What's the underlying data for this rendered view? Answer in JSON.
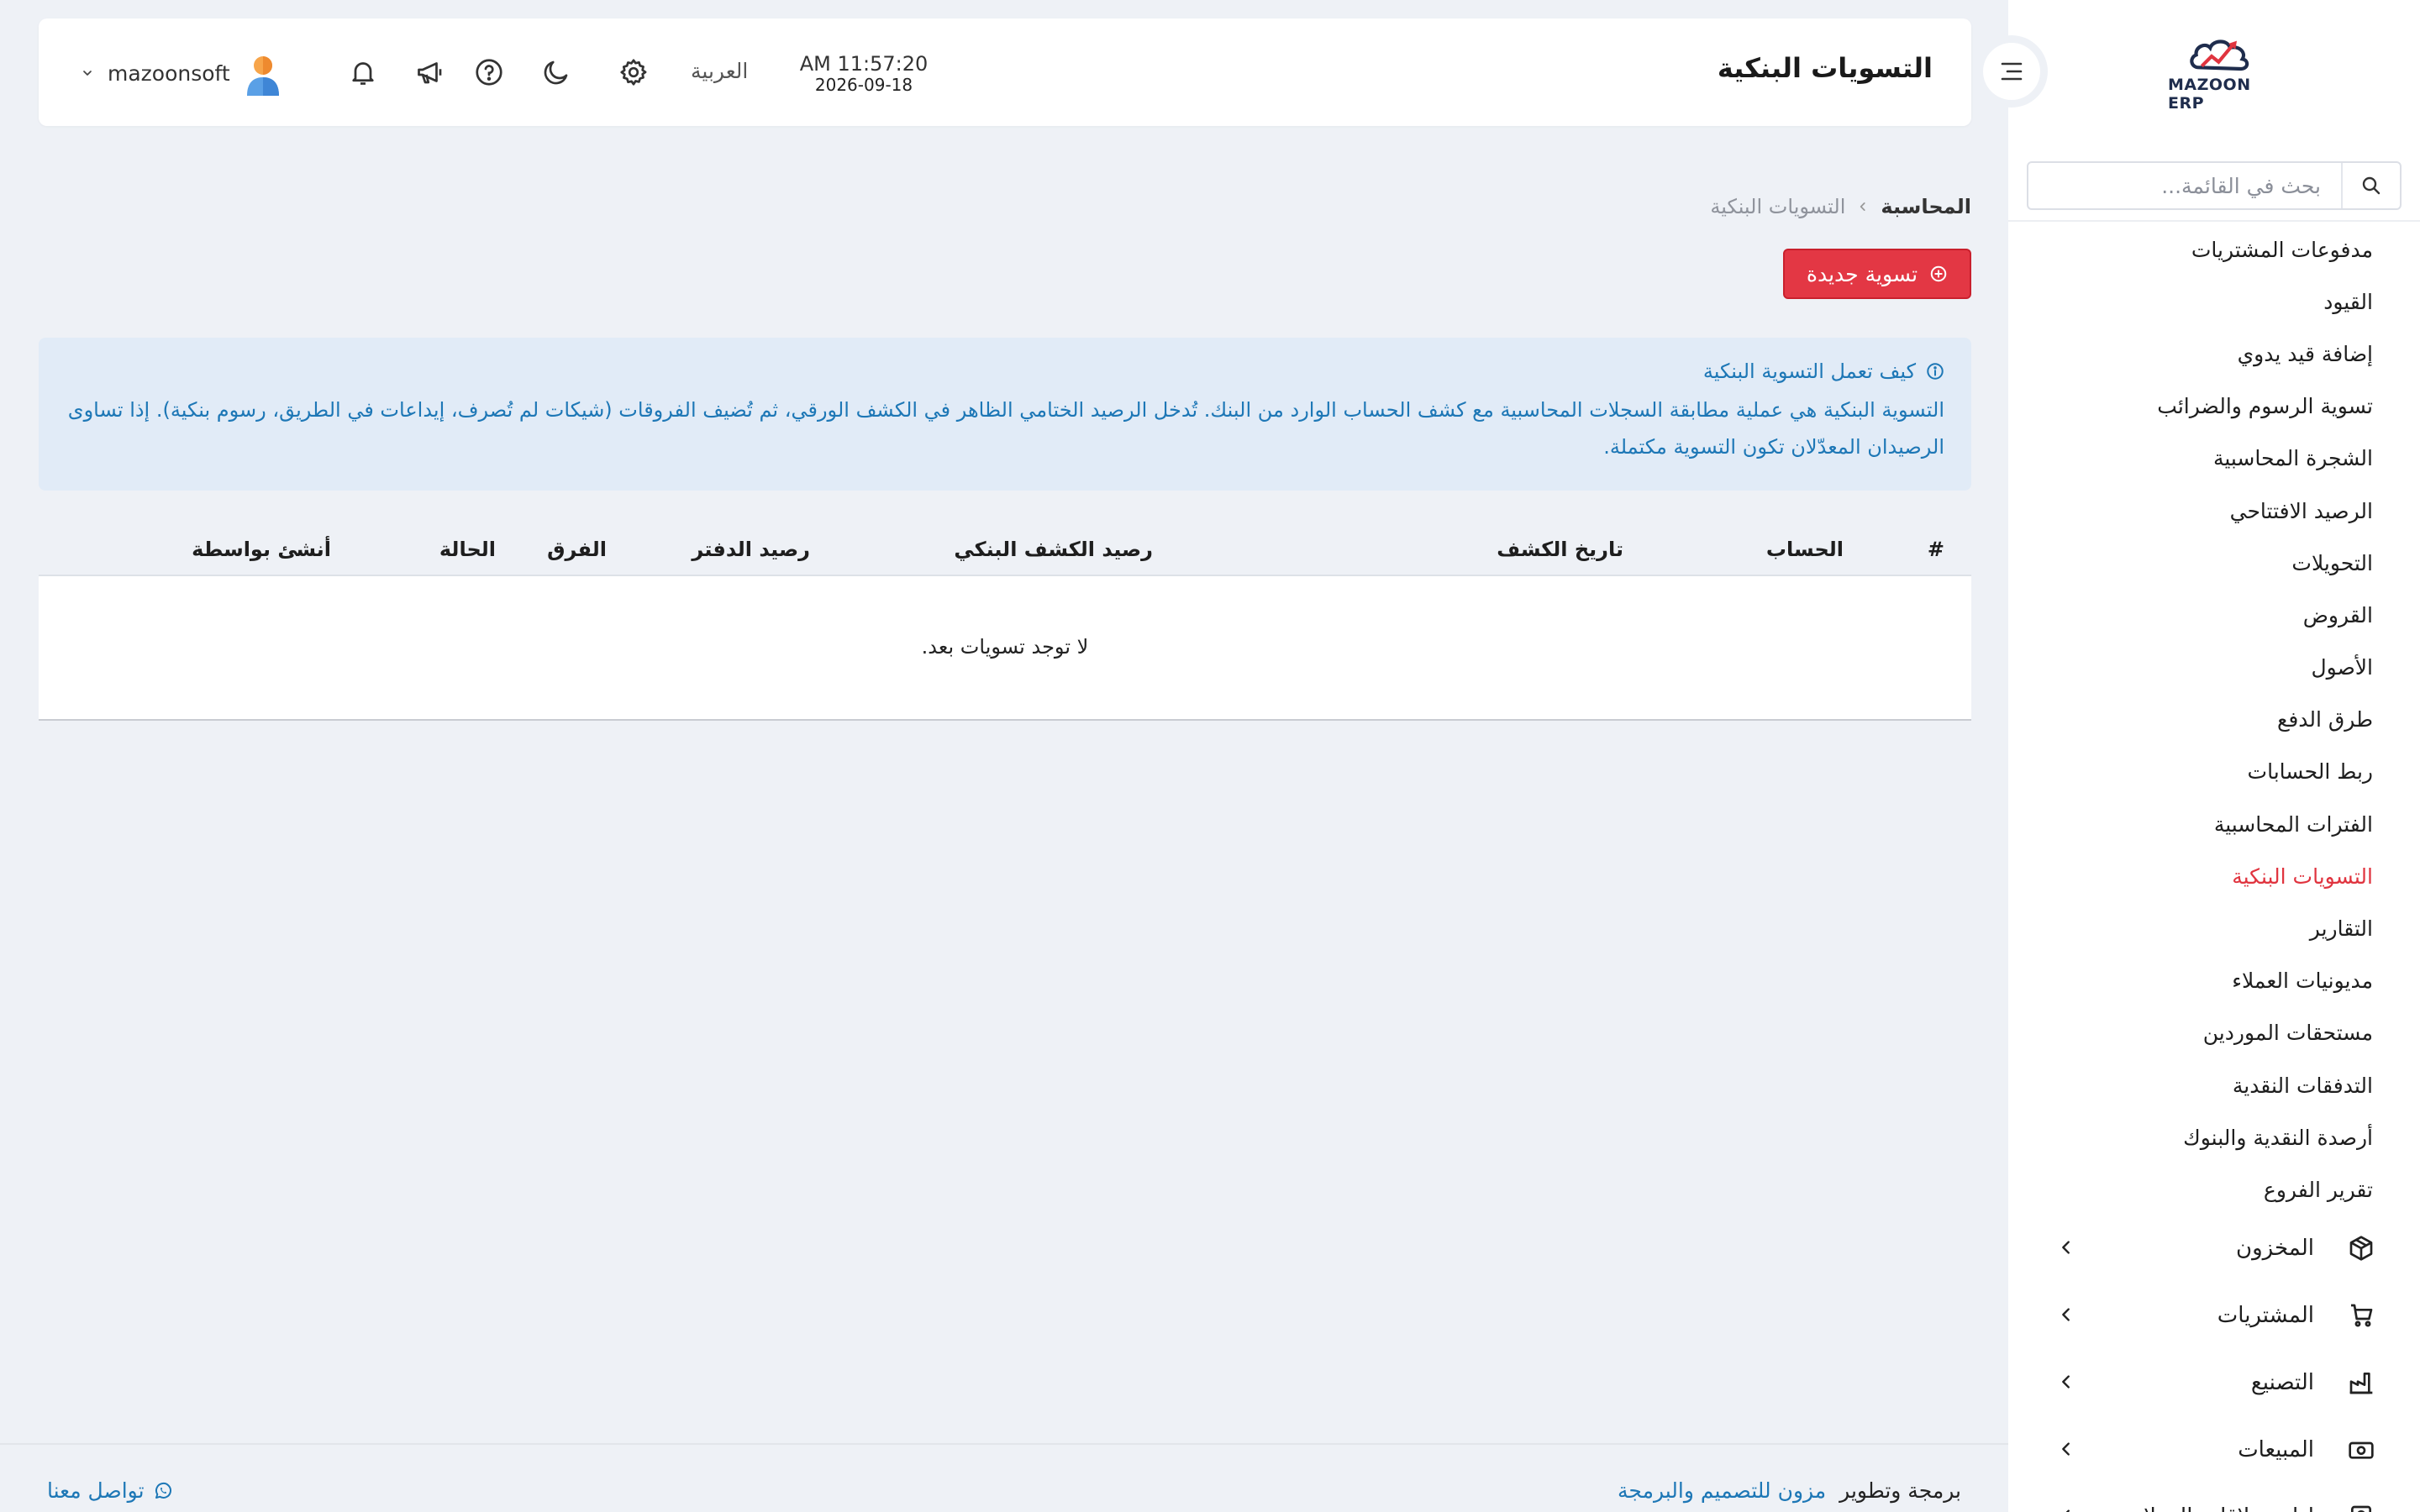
{
  "brand": {
    "logo_text": "MAZOON ERP",
    "logo_small": "ERP"
  },
  "header": {
    "title": "التسويات البنكية",
    "time": "AM 11:57:20",
    "date": "2026-09-18",
    "language": "العربية",
    "username": "mazoonsoft",
    "icons": [
      "settings-icon",
      "moon-icon",
      "help-icon",
      "megaphone-icon",
      "bell-icon"
    ]
  },
  "sidebar": {
    "search_placeholder": "بحث في القائمة...",
    "submenu": [
      "مدفوعات المشتريات",
      "القيود",
      "إضافة قيد يدوي",
      "تسوية الرسوم والضرائب",
      "الشجرة المحاسبية",
      "الرصيد الافتتاحي",
      "التحويلات",
      "القروض",
      "الأصول",
      "طرق الدفع",
      "ربط الحسابات",
      "الفترات المحاسبية",
      "التسويات البنكية",
      "التقارير",
      "مديونيات العملاء",
      "مستحقات الموردين",
      "التدفقات النقدية",
      "أرصدة النقدية والبنوك",
      "تقرير الفروع"
    ],
    "active_index": 12,
    "modules": [
      {
        "label": "المخزون",
        "icon": "box-icon"
      },
      {
        "label": "المشتريات",
        "icon": "cart-icon"
      },
      {
        "label": "التصنيع",
        "icon": "factory-icon"
      },
      {
        "label": "المبيعات",
        "icon": "cash-icon"
      },
      {
        "label": "إدارة علاقات العملاء",
        "icon": "contacts-icon"
      }
    ]
  },
  "breadcrumb": {
    "root": "المحاسبة",
    "current": "التسويات البنكية"
  },
  "actions": {
    "new_label": "تسوية جديدة"
  },
  "info": {
    "title": "كيف تعمل التسوية البنكية",
    "body": "التسوية البنكية هي عملية مطابقة السجلات المحاسبية مع كشف الحساب الوارد من البنك. تُدخل الرصيد الختامي الظاهر في الكشف الورقي، ثم تُضيف الفروقات (شيكات لم تُصرف، إيداعات في الطريق، رسوم بنكية). إذا تساوى الرصيدان المعدّلان تكون التسوية مكتملة."
  },
  "table": {
    "columns": [
      "#",
      "الحساب",
      "تاريخ الكشف",
      "رصيد الكشف البنكي",
      "رصيد الدفتر",
      "الفرق",
      "الحالة",
      "أنشئ بواسطة"
    ],
    "empty_message": "لا توجد تسويات بعد."
  },
  "footer": {
    "credit_label": "برمجة وتطوير",
    "credit_link": "مزون للتصميم والبرمجة",
    "contact": "تواصل معنا"
  },
  "colors": {
    "accent": "#e33744",
    "info_text": "#1d77b6",
    "info_bg": "#e1ebf7",
    "background": "#eef1f6"
  }
}
